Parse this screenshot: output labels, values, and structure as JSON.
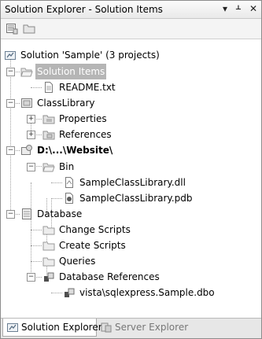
{
  "window": {
    "title": "Solution Explorer - Solution Items",
    "pin_icon": "pushpin-icon",
    "dropdown_icon": "chevron-down-icon",
    "close_icon": "close-icon"
  },
  "toolbar": {
    "buttons": [
      "properties-icon",
      "new-folder-icon"
    ]
  },
  "tree": {
    "solution": "Solution 'Sample' (3 projects)",
    "solution_items": "Solution Items",
    "readme": "README.txt",
    "classlibrary": "ClassLibrary",
    "properties": "Properties",
    "references": "References",
    "website": "D:\\...\\Website\\",
    "bin": "Bin",
    "dll": "SampleClassLibrary.dll",
    "pdb": "SampleClassLibrary.pdb",
    "database": "Database",
    "change_scripts": "Change Scripts",
    "create_scripts": "Create Scripts",
    "queries": "Queries",
    "db_references": "Database References",
    "dbo": "vista\\sqlexpress.Sample.dbo"
  },
  "tabs": {
    "solution_explorer": "Solution Explorer",
    "server_explorer": "Server Explorer"
  }
}
